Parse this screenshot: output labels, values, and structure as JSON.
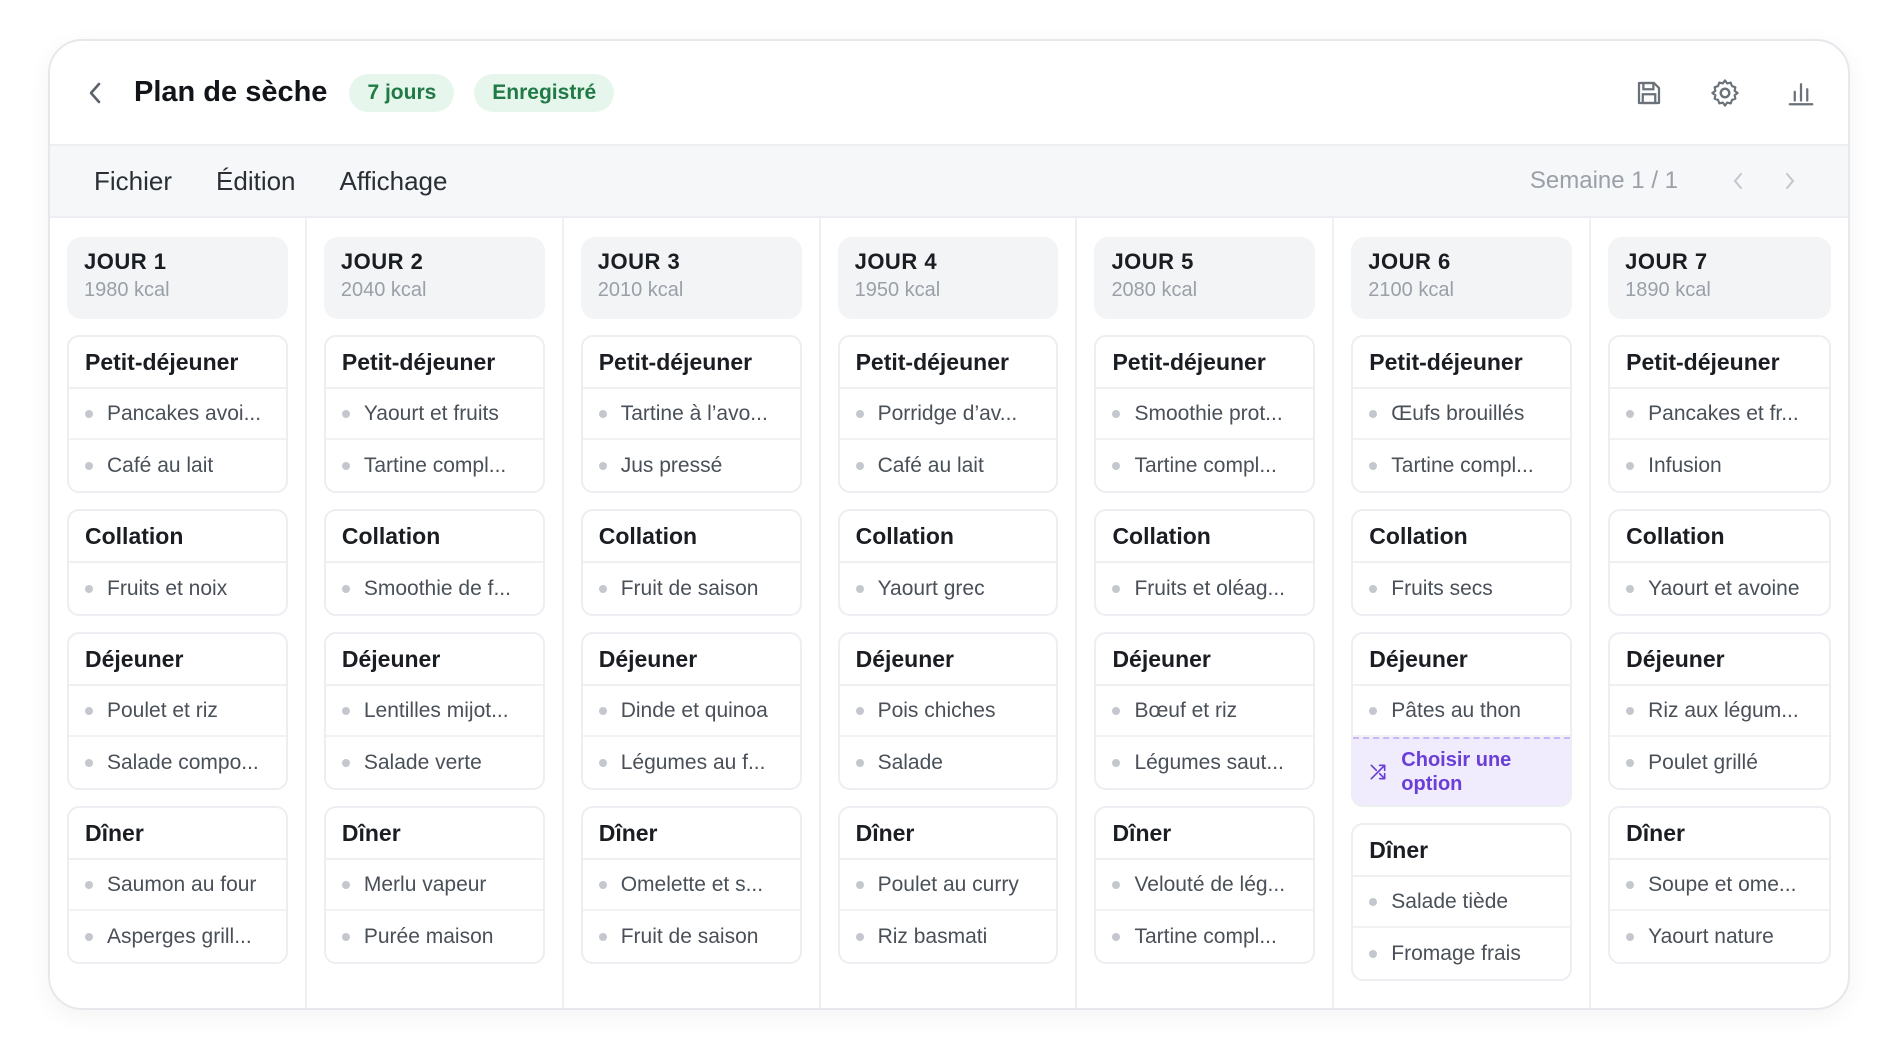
{
  "header": {
    "title": "Plan de sèche",
    "duration_badge": "7 jours",
    "status_badge": "Enregistré",
    "icons": [
      "save-icon",
      "settings-gear-icon",
      "bar-chart-icon"
    ]
  },
  "menu": {
    "items": [
      "Fichier",
      "Édition",
      "Affichage"
    ],
    "week_label": "Semaine 1 / 1"
  },
  "colors": {
    "badge_bg": "#e7f6ec",
    "badge_text": "#1f7a45",
    "accent_purple": "#6a3fd8"
  },
  "choose_option_label": "Choisir une option",
  "days": [
    {
      "name": "JOUR 1",
      "kcal": "1980 kcal",
      "meals": [
        {
          "title": "Petit-déjeuner",
          "items": [
            "Pancakes avoi...",
            "Café au lait"
          ]
        },
        {
          "title": "Collation",
          "items": [
            "Fruits et noix"
          ]
        },
        {
          "title": "Déjeuner",
          "items": [
            "Poulet et riz",
            "Salade compo..."
          ]
        },
        {
          "title": "Dîner",
          "items": [
            "Saumon au four",
            "Asperges grill..."
          ]
        }
      ]
    },
    {
      "name": "JOUR 2",
      "kcal": "2040 kcal",
      "meals": [
        {
          "title": "Petit-déjeuner",
          "items": [
            "Yaourt et fruits",
            "Tartine compl..."
          ]
        },
        {
          "title": "Collation",
          "items": [
            "Smoothie de f..."
          ]
        },
        {
          "title": "Déjeuner",
          "items": [
            "Lentilles mijot...",
            "Salade verte"
          ]
        },
        {
          "title": "Dîner",
          "items": [
            "Merlu vapeur",
            "Purée maison"
          ]
        }
      ]
    },
    {
      "name": "JOUR 3",
      "kcal": "2010 kcal",
      "meals": [
        {
          "title": "Petit-déjeuner",
          "items": [
            "Tartine à l’avo...",
            "Jus pressé"
          ]
        },
        {
          "title": "Collation",
          "items": [
            "Fruit de saison"
          ]
        },
        {
          "title": "Déjeuner",
          "items": [
            "Dinde et quinoa",
            "Légumes au f..."
          ]
        },
        {
          "title": "Dîner",
          "items": [
            "Omelette et s...",
            "Fruit de saison"
          ]
        }
      ]
    },
    {
      "name": "JOUR 4",
      "kcal": "1950 kcal",
      "meals": [
        {
          "title": "Petit-déjeuner",
          "items": [
            "Porridge d’av...",
            "Café au lait"
          ]
        },
        {
          "title": "Collation",
          "items": [
            "Yaourt grec"
          ]
        },
        {
          "title": "Déjeuner",
          "items": [
            "Pois chiches",
            "Salade"
          ]
        },
        {
          "title": "Dîner",
          "items": [
            "Poulet au curry",
            "Riz basmati"
          ]
        }
      ]
    },
    {
      "name": "JOUR 5",
      "kcal": "2080 kcal",
      "meals": [
        {
          "title": "Petit-déjeuner",
          "items": [
            "Smoothie prot...",
            "Tartine compl..."
          ]
        },
        {
          "title": "Collation",
          "items": [
            "Fruits et oléag..."
          ]
        },
        {
          "title": "Déjeuner",
          "items": [
            "Bœuf et riz",
            "Légumes saut..."
          ]
        },
        {
          "title": "Dîner",
          "items": [
            "Velouté de lég...",
            "Tartine compl..."
          ]
        }
      ]
    },
    {
      "name": "JOUR 6",
      "kcal": "2100 kcal",
      "meals": [
        {
          "title": "Petit-déjeuner",
          "items": [
            "Œufs brouillés",
            "Tartine compl..."
          ]
        },
        {
          "title": "Collation",
          "items": [
            "Fruits secs"
          ]
        },
        {
          "title": "Déjeuner",
          "items": [
            "Pâtes au thon"
          ],
          "choose": true
        },
        {
          "title": "Dîner",
          "items": [
            "Salade tiède",
            "Fromage frais"
          ]
        }
      ]
    },
    {
      "name": "JOUR 7",
      "kcal": "1890 kcal",
      "meals": [
        {
          "title": "Petit-déjeuner",
          "items": [
            "Pancakes et fr...",
            "Infusion"
          ]
        },
        {
          "title": "Collation",
          "items": [
            "Yaourt et avoine"
          ]
        },
        {
          "title": "Déjeuner",
          "items": [
            "Riz aux légum...",
            "Poulet grillé"
          ]
        },
        {
          "title": "Dîner",
          "items": [
            "Soupe et ome...",
            "Yaourt nature"
          ]
        }
      ]
    }
  ]
}
